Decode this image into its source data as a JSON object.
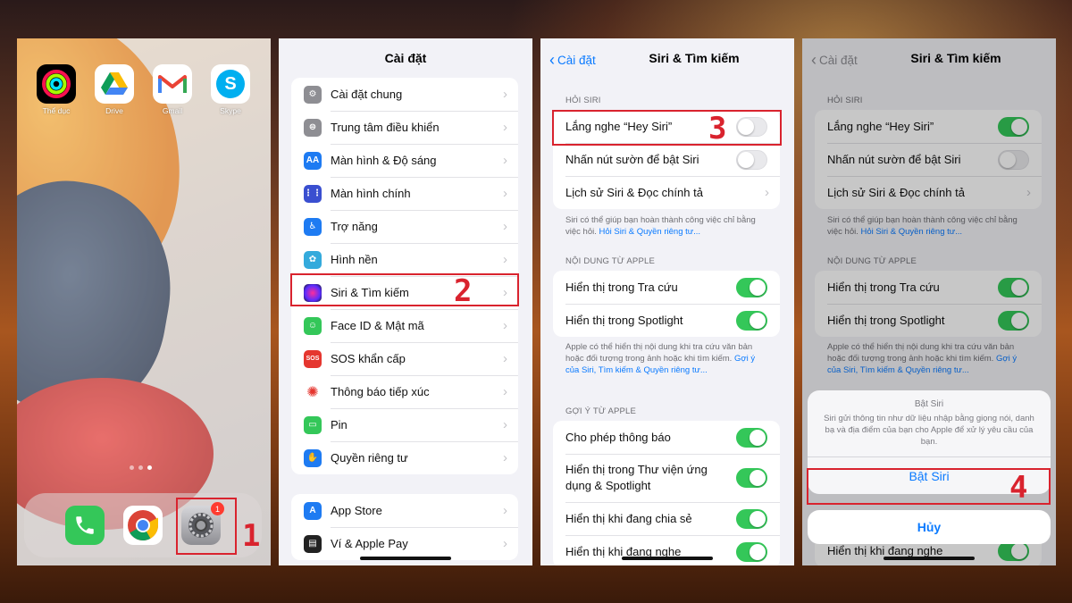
{
  "home": {
    "apps": [
      {
        "label": "Thể dục",
        "icon": "activity-rings-icon"
      },
      {
        "label": "Drive",
        "icon": "google-drive-icon"
      },
      {
        "label": "Gmail",
        "icon": "gmail-icon"
      },
      {
        "label": "Skype",
        "icon": "skype-icon"
      }
    ],
    "dock": [
      {
        "icon": "phone-icon"
      },
      {
        "icon": "chrome-icon"
      },
      {
        "icon": "settings-gear-icon",
        "badge": "1"
      }
    ],
    "step": "1"
  },
  "settings": {
    "title": "Cài đặt",
    "group1": [
      {
        "label": "Cài đặt chung",
        "icon": "gear-icon",
        "color": "#8e8e93"
      },
      {
        "label": "Trung tâm điều khiển",
        "icon": "switches-icon",
        "color": "#8e8e93"
      },
      {
        "label": "Màn hình & Độ sáng",
        "icon": "text-size-icon",
        "color": "#1e7bf2"
      },
      {
        "label": "Màn hình chính",
        "icon": "grid-icon",
        "color": "#3a4fd0"
      },
      {
        "label": "Trợ năng",
        "icon": "accessibility-icon",
        "color": "#1e7bf2"
      },
      {
        "label": "Hình nền",
        "icon": "flower-icon",
        "color": "#34aadc"
      },
      {
        "label": "Siri & Tìm kiếm",
        "icon": "siri-icon",
        "color": "#222"
      },
      {
        "label": "Face ID & Mật mã",
        "icon": "face-id-icon",
        "color": "#34c759"
      },
      {
        "label": "SOS khẩn cấp",
        "icon": "sos-icon",
        "color": "#e5362f"
      },
      {
        "label": "Thông báo tiếp xúc",
        "icon": "exposure-icon",
        "color": "#fff"
      },
      {
        "label": "Pin",
        "icon": "battery-icon",
        "color": "#34c759"
      },
      {
        "label": "Quyền riêng tư",
        "icon": "hand-icon",
        "color": "#1e7bf2"
      }
    ],
    "group2": [
      {
        "label": "App Store",
        "icon": "app-store-icon",
        "color": "#1e7bf2"
      },
      {
        "label": "Ví & Apple Pay",
        "icon": "wallet-icon",
        "color": "#222"
      }
    ],
    "step": "2"
  },
  "siri": {
    "back": "Cài đặt",
    "title": "Siri & Tìm kiếm",
    "sec_ask": "HỎI SIRI",
    "ask_rows": [
      {
        "label": "Lắng nghe “Hey Siri”",
        "type": "toggle",
        "on": false
      },
      {
        "label": "Nhấn nút sườn để bật Siri",
        "type": "toggle",
        "on": false
      },
      {
        "label": "Lịch sử Siri & Đọc chính tả",
        "type": "chevron"
      }
    ],
    "ask_foot": "Siri có thể giúp bạn hoàn thành công việc chỉ bằng việc hỏi.",
    "ask_link": "Hỏi Siri & Quyền riêng tư...",
    "sec_apple": "NỘI DUNG TỪ APPLE",
    "apple_rows": [
      {
        "label": "Hiển thị trong Tra cứu",
        "on": true
      },
      {
        "label": "Hiển thị trong Spotlight",
        "on": true
      }
    ],
    "apple_foot": "Apple có thể hiển thị nội dung khi tra cứu văn bản hoặc đối tượng trong ảnh hoặc khi tìm kiếm.",
    "apple_link": "Gợi ý của Siri, Tìm kiếm & Quyền riêng tư...",
    "sec_sugg": "GỢI Ý TỪ APPLE",
    "sugg_rows": [
      {
        "label": "Cho phép thông báo",
        "on": true
      },
      {
        "label": "Hiển thị trong Thư viện ứng dụng & Spotlight",
        "on": true
      },
      {
        "label": "Hiển thị khi đang chia sẻ",
        "on": true
      },
      {
        "label": "Hiển thị khi đang nghe",
        "on": true
      }
    ],
    "step": "3"
  },
  "siri2": {
    "back": "Cài đặt",
    "title": "Siri & Tìm kiếm",
    "sec_ask": "HỎI SIRI",
    "ask_rows": [
      {
        "label": "Lắng nghe “Hey Siri”",
        "on": true
      },
      {
        "label": "Nhấn nút sườn để bật Siri",
        "on": false
      },
      {
        "label": "Lịch sử Siri & Đọc chính tả"
      }
    ],
    "ask_foot": "Siri có thể giúp bạn hoàn thành công việc chỉ bằng việc hỏi.",
    "ask_link": "Hỏi Siri & Quyền riêng tư...",
    "sec_apple": "NỘI DUNG TỪ APPLE",
    "apple_rows": [
      {
        "label": "Hiển thị trong Tra cứu",
        "on": true
      },
      {
        "label": "Hiển thị trong Spotlight",
        "on": true
      }
    ],
    "apple_foot": "Apple có thể hiển thị nội dung khi tra cứu văn bản hoặc đối tượng trong ảnh hoặc khi tìm kiếm.",
    "apple_link": "Gợi ý của Siri, Tìm kiếm & Quyền riêng tư...",
    "last_row": "Hiển thị khi đang nghe",
    "sheet": {
      "title": "Bật Siri",
      "body": "Siri gửi thông tin như dữ liệu nhập bằng giọng nói, danh bạ và địa điểm của bạn cho Apple để xử lý yêu cầu của bạn.",
      "action": "Bật Siri",
      "cancel": "Hủy"
    },
    "step": "4"
  }
}
